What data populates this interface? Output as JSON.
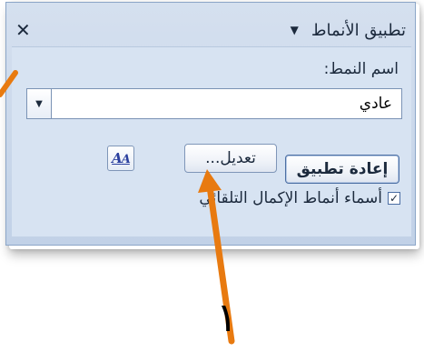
{
  "pane": {
    "title": "تطبيق الأنماط",
    "dropdown_icon": "triangle-down-icon",
    "close_icon": "close-icon"
  },
  "style_name": {
    "label": "اسم النمط:",
    "value": "عادي",
    "dropdown_icon": "chevron-down-icon"
  },
  "buttons": {
    "reapply": "إعادة تطبيق",
    "modify": "تعديل...",
    "styles_icon_glyph": "A"
  },
  "autocomplete": {
    "label": "أسماء أنماط الإكمال التلقائي",
    "checked": true,
    "check_mark": "✓"
  },
  "annotation": {
    "number": "١",
    "arrow_color": "#e87a10"
  },
  "colors": {
    "pane_bg": "#c9d7ea",
    "pane_border": "#8ca6c8",
    "text": "#1c2a3d",
    "button_accent": "#4b6ea3"
  }
}
